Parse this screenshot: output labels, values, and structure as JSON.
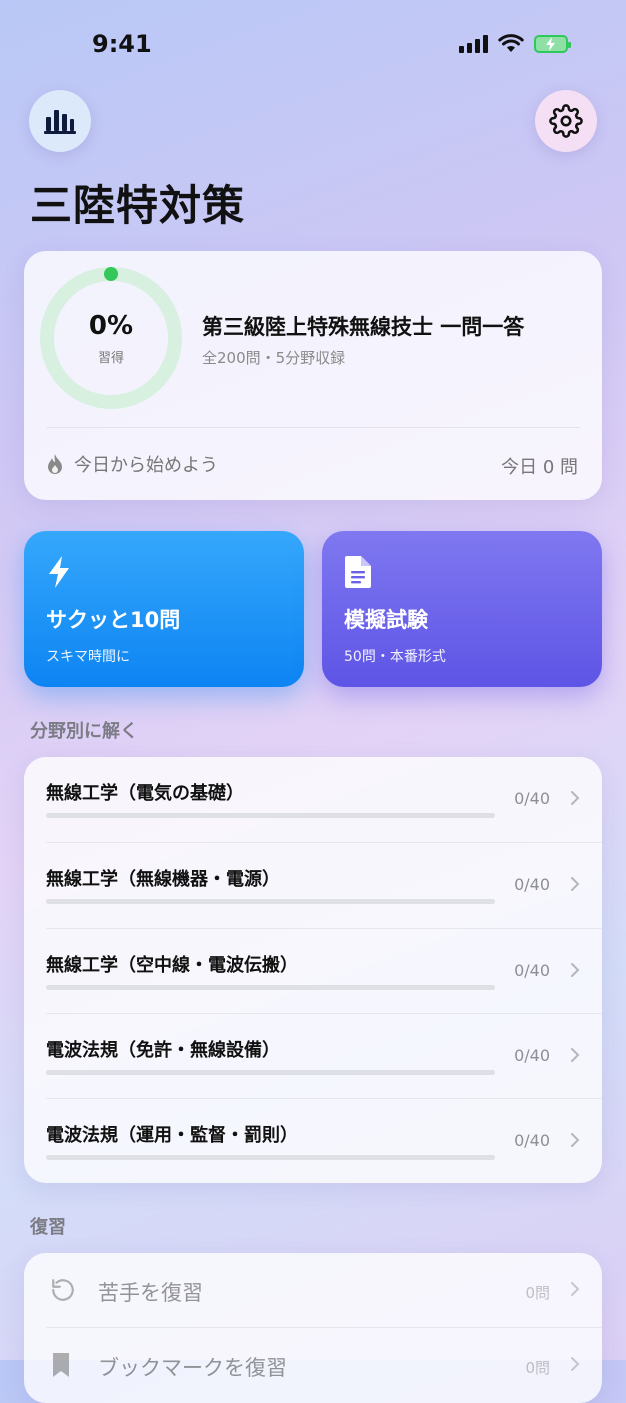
{
  "status_bar": {
    "time": "9:41"
  },
  "app": {
    "title": "三陸特対策"
  },
  "progress": {
    "percent_label": "0%",
    "percent_value": 0,
    "caption": "習得",
    "exam_title": "第三級陸上特殊無線技士 一問一答",
    "exam_subtitle": "全200問・5分野収録",
    "streak_text": "今日から始めよう",
    "today_text": "今日 0 問"
  },
  "actions": {
    "quick": {
      "title": "サクッと10問",
      "subtitle": "スキマ時間に"
    },
    "mock": {
      "title": "模擬試験",
      "subtitle": "50問・本番形式"
    }
  },
  "categories_header": "分野別に解く",
  "categories": [
    {
      "label": "無線工学（電気の基礎）",
      "count": "0/40",
      "progress": 0
    },
    {
      "label": "無線工学（無線機器・電源）",
      "count": "0/40",
      "progress": 0
    },
    {
      "label": "無線工学（空中線・電波伝搬）",
      "count": "0/40",
      "progress": 0
    },
    {
      "label": "電波法規（免許・無線設備）",
      "count": "0/40",
      "progress": 0
    },
    {
      "label": "電波法規（運用・監督・罰則）",
      "count": "0/40",
      "progress": 0
    }
  ],
  "review_header": "復習",
  "review": [
    {
      "label": "苦手を復習",
      "count": "0問",
      "icon": "rotate-ccw-icon"
    },
    {
      "label": "ブックマークを復習",
      "count": "0問",
      "icon": "bookmark-icon"
    }
  ],
  "colors": {
    "accent_blue": "#0d84f3",
    "accent_purple": "#5e54e6",
    "ring_green": "#34c759"
  }
}
